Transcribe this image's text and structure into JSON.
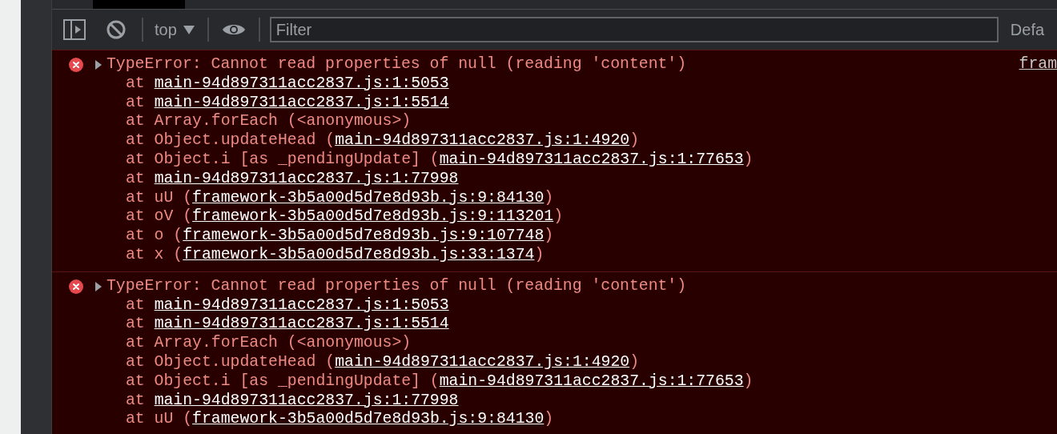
{
  "toolbar": {
    "context": "top",
    "filter": {
      "placeholder": "Filter"
    },
    "levels": "Defa"
  },
  "messages": [
    {
      "expanded": false,
      "text": "TypeError: Cannot read properties of null (reading 'content')",
      "source": "fram",
      "stack": [
        {
          "before": "at ",
          "link": "main-94d897311acc2837.js:1:5053"
        },
        {
          "before": "at ",
          "link": "main-94d897311acc2837.js:1:5514"
        },
        {
          "before": "at Array.forEach (<anonymous>)"
        },
        {
          "before": "at Object.updateHead (",
          "link": "main-94d897311acc2837.js:1:4920",
          "after": ")"
        },
        {
          "before": "at Object.i [as _pendingUpdate] (",
          "link": "main-94d897311acc2837.js:1:77653",
          "after": ")"
        },
        {
          "before": "at ",
          "link": "main-94d897311acc2837.js:1:77998"
        },
        {
          "before": "at uU (",
          "link": "framework-3b5a00d5d7e8d93b.js:9:84130",
          "after": ")"
        },
        {
          "before": "at oV (",
          "link": "framework-3b5a00d5d7e8d93b.js:9:113201",
          "after": ")"
        },
        {
          "before": "at o (",
          "link": "framework-3b5a00d5d7e8d93b.js:9:107748",
          "after": ")"
        },
        {
          "before": "at x (",
          "link": "framework-3b5a00d5d7e8d93b.js:33:1374",
          "after": ")"
        }
      ]
    },
    {
      "expanded": false,
      "text": "TypeError: Cannot read properties of null (reading 'content')",
      "stack": [
        {
          "before": "at ",
          "link": "main-94d897311acc2837.js:1:5053"
        },
        {
          "before": "at ",
          "link": "main-94d897311acc2837.js:1:5514"
        },
        {
          "before": "at Array.forEach (<anonymous>)"
        },
        {
          "before": "at Object.updateHead (",
          "link": "main-94d897311acc2837.js:1:4920",
          "after": ")"
        },
        {
          "before": "at Object.i [as _pendingUpdate] (",
          "link": "main-94d897311acc2837.js:1:77653",
          "after": ")"
        },
        {
          "before": "at ",
          "link": "main-94d897311acc2837.js:1:77998"
        },
        {
          "before": "at uU (",
          "link": "framework-3b5a00d5d7e8d93b.js:9:84130",
          "after": ")"
        }
      ]
    }
  ]
}
